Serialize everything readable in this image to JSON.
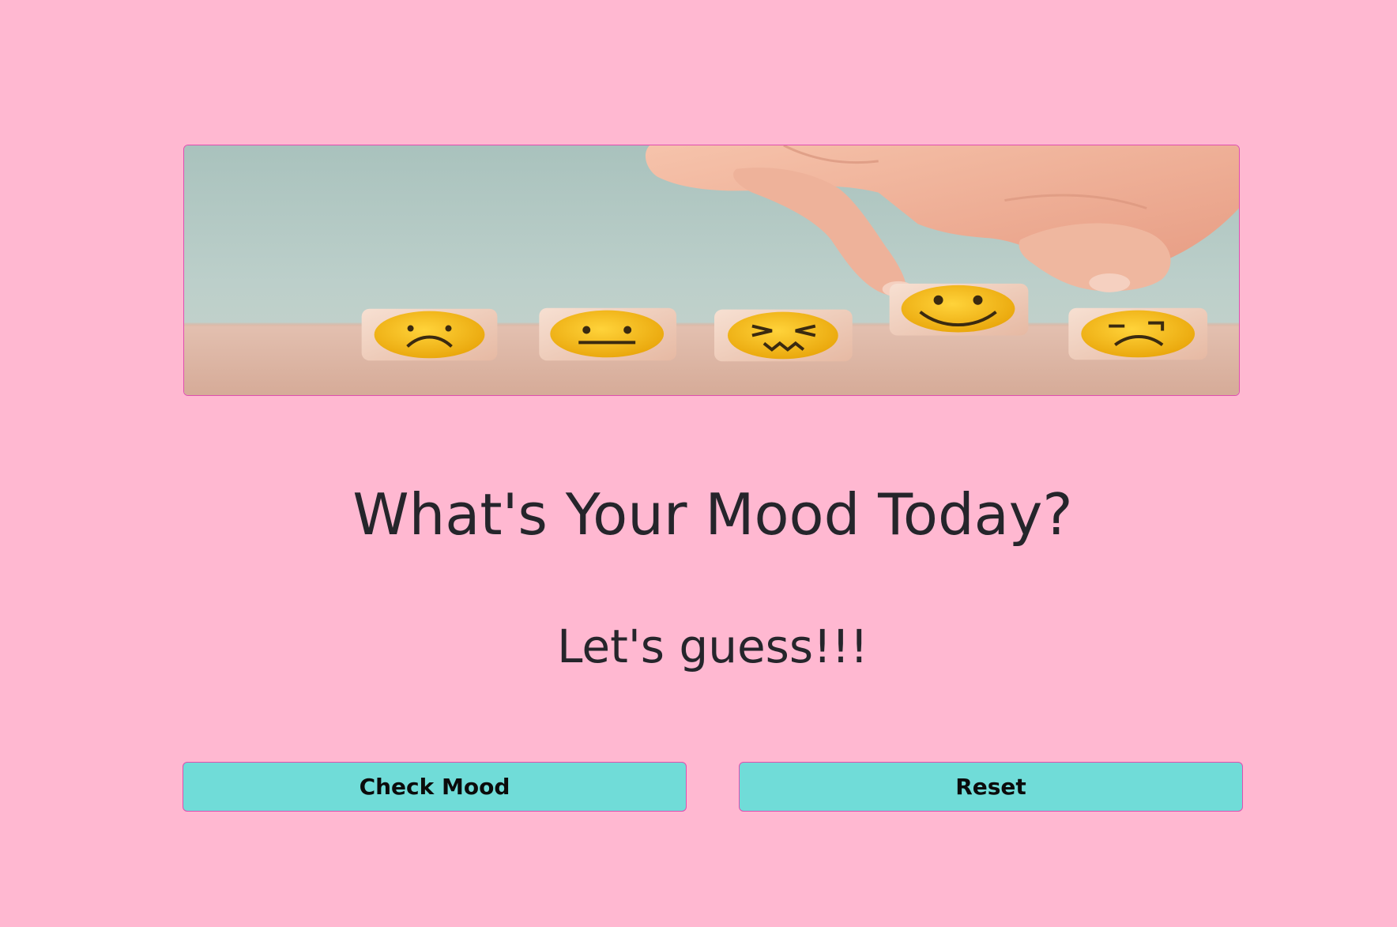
{
  "hero": {
    "image_alt": "emoji dice mood image",
    "colors": {
      "backdrop": "#b8cbc6",
      "table": "#ddb5a3",
      "face": "#f4b81a",
      "skin": "#f2b39a"
    }
  },
  "heading": {
    "title": "What's Your Mood Today?",
    "subtitle": "Let's guess!!!"
  },
  "buttons": {
    "check_mood": "Check Mood",
    "reset": "Reset"
  },
  "theme": {
    "background": "#ffb8d1",
    "button": "#70dcd8",
    "border": "#e04eb0"
  }
}
